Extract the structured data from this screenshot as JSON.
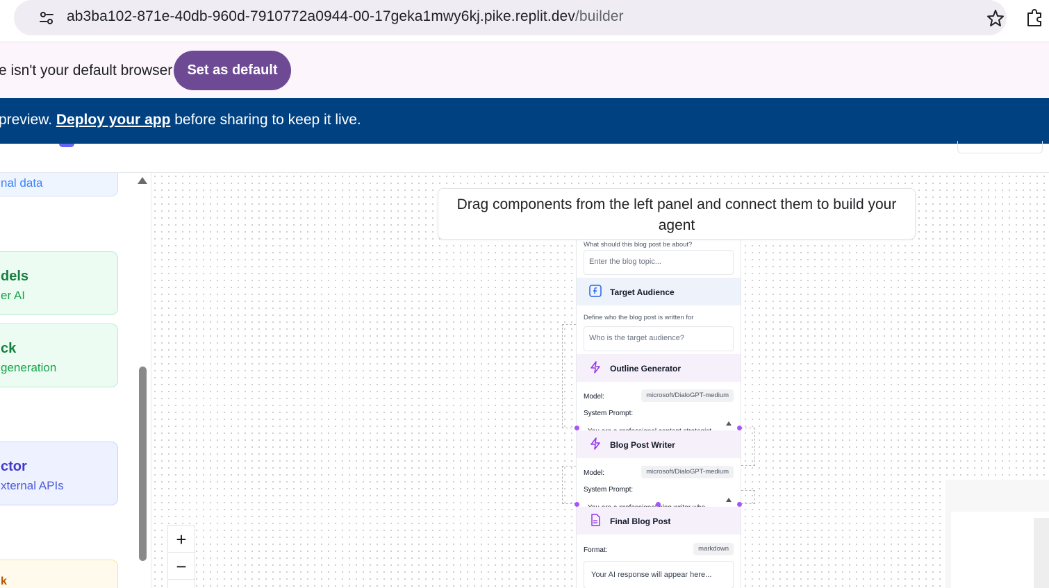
{
  "browser": {
    "url_main": "ab3ba102-871e-40db-960d-7910772a0944-00-17geka1mwy6kj.pike.replit.dev",
    "url_path": "/builder"
  },
  "infobar": {
    "text": "e isn't your default browser",
    "button": "Set as default"
  },
  "banner": {
    "prefix": "preview. ",
    "link": "Deploy your app",
    "suffix": " before sharing to keep it live."
  },
  "sidebar": {
    "cards": [
      {
        "title": "",
        "subtitle": "nal data"
      },
      {
        "title": "dels",
        "subtitle": "er AI"
      },
      {
        "title": "ck",
        "subtitle": "generation"
      },
      {
        "title": "ctor",
        "subtitle": "xternal APIs"
      },
      {
        "title": "k",
        "subtitle": ""
      }
    ]
  },
  "canvas": {
    "hint": "Drag components from the left panel and connect them to build your agent",
    "zoom_in": "+",
    "zoom_out": "−"
  },
  "nodes": {
    "topic": {
      "description": "What should this blog post be about?",
      "placeholder": "Enter the blog topic..."
    },
    "audience": {
      "title": "Target Audience",
      "description": "Define who the blog post is written for",
      "placeholder": "Who is the target audience?"
    },
    "outline": {
      "title": "Outline Generator",
      "model_label": "Model:",
      "model": "microsoft/DialoGPT-medium",
      "prompt_label": "System Prompt:",
      "prompt_preview": "You are a professional content strategist"
    },
    "writer": {
      "title": "Blog Post Writer",
      "model_label": "Model:",
      "model": "microsoft/DialoGPT-medium",
      "prompt_label": "System Prompt:",
      "prompt_preview": "You are a professional blog writer who"
    },
    "final": {
      "title": "Final Blog Post",
      "format_label": "Format:",
      "format": "markdown",
      "placeholder": "Your AI response will appear here..."
    }
  },
  "colors": {
    "brand_button": "#6e4a94",
    "banner": "#004182",
    "handle": "#a855f7"
  }
}
